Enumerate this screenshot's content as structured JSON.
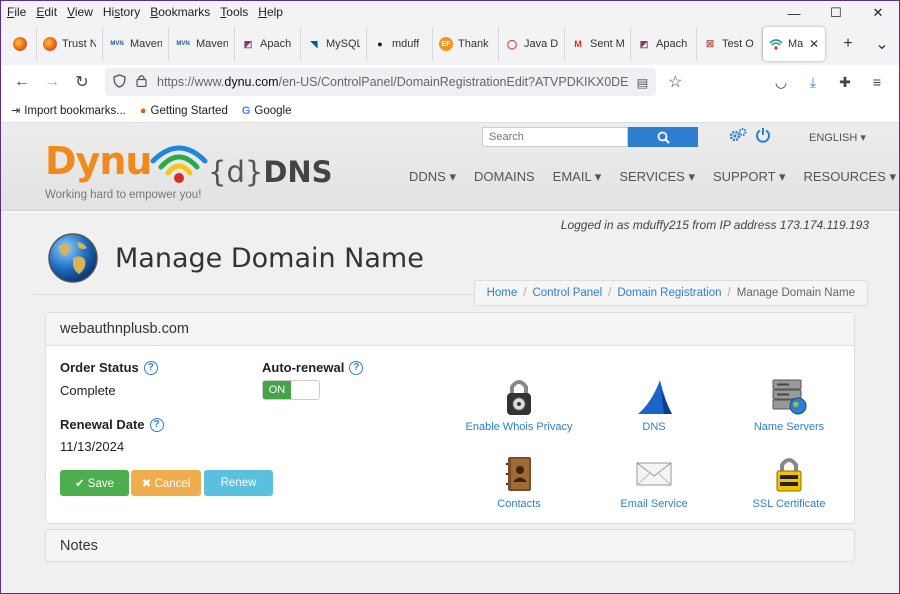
{
  "menubar": {
    "items": [
      {
        "pre": "",
        "ul": "F",
        "post": "ile"
      },
      {
        "pre": "",
        "ul": "E",
        "post": "dit"
      },
      {
        "pre": "",
        "ul": "V",
        "post": "iew"
      },
      {
        "pre": "Hi",
        "ul": "s",
        "post": "tory"
      },
      {
        "pre": "",
        "ul": "B",
        "post": "ookmarks"
      },
      {
        "pre": "",
        "ul": "T",
        "post": "ools"
      },
      {
        "pre": "",
        "ul": "H",
        "post": "elp"
      }
    ]
  },
  "window": {
    "minimize": "—",
    "maximize": "☐",
    "close": "✕"
  },
  "tabs": [
    {
      "label": "Trust Nexu",
      "icon": "firefox-icon",
      "glyph": "",
      "color": "#e66000"
    },
    {
      "label": "Maven",
      "icon": "maven-icon",
      "glyph": "MVN",
      "color": "#1e5b9c"
    },
    {
      "label": "Maven",
      "icon": "maven-icon",
      "glyph": "MVN",
      "color": "#1e5b9c"
    },
    {
      "label": "Apach",
      "icon": "apache-icon",
      "glyph": "◩",
      "color": "#8a3b6b"
    },
    {
      "label": "MySQL",
      "icon": "mysql-icon",
      "glyph": "◥",
      "color": "#00618a"
    },
    {
      "label": "mduff",
      "icon": "github-icon",
      "glyph": "●",
      "color": "#111111"
    },
    {
      "label": "Thank",
      "icon": "ef-icon",
      "glyph": "EF",
      "color": "#f7941d"
    },
    {
      "label": "Java D",
      "icon": "oracle-icon",
      "glyph": "◯",
      "color": "#e0301e"
    },
    {
      "label": "Sent M",
      "icon": "gmail-icon",
      "glyph": "M",
      "color": "#d93025"
    },
    {
      "label": "Apach",
      "icon": "apache-icon",
      "glyph": "◩",
      "color": "#8a3b6b"
    },
    {
      "label": "Test O",
      "icon": "test-icon",
      "glyph": "☒",
      "color": "#b03a2e"
    },
    {
      "label": "Mai",
      "icon": "dynu-wifi-icon",
      "glyph": "",
      "color": "#2e9b3a",
      "active": true
    }
  ],
  "tab_tools": {
    "new_tab": "+",
    "list_all": "⌄"
  },
  "nav": {
    "back": "←",
    "forward": "→",
    "reload": "↻",
    "url_prefix": "https://www.",
    "url_domain": "dynu.com",
    "url_rest": "/en-US/ControlPanel/DomainRegistrationEdit?ATVPDKIKX0DE",
    "reader": "▤",
    "star": "☆",
    "pocket": "◡",
    "download": "⤓",
    "extensions": "✚",
    "menu": "≡"
  },
  "bookmarks": [
    {
      "label": "Import bookmarks...",
      "icon": "import-icon",
      "glyph": "⇥"
    },
    {
      "label": "Getting Started",
      "icon": "firefox-icon",
      "glyph": "●"
    },
    {
      "label": "Google",
      "icon": "google-icon",
      "glyph": "G"
    }
  ],
  "header": {
    "logo_text": "Dynu",
    "tagline": "Working hard to empower you!",
    "ddns_brace": "{d}",
    "ddns_text": "DNS",
    "search_placeholder": "Search",
    "lang": "ENGLISH ▾",
    "nav": [
      "DDNS ▾",
      "DOMAINS",
      "EMAIL ▾",
      "SERVICES ▾",
      "SUPPORT ▾",
      "RESOURCES ▾"
    ]
  },
  "session": {
    "logged_in": "Logged in as mduffy215 from IP address 173.174.119.193"
  },
  "page": {
    "title": "Manage Domain Name"
  },
  "breadcrumb": {
    "items": [
      "Home",
      "Control Panel",
      "Domain Registration"
    ],
    "current": "Manage Domain Name"
  },
  "domain": {
    "name": "webauthnplusb.com",
    "order_status_label": "Order Status",
    "order_status": "Complete",
    "auto_renewal_label": "Auto-renewal",
    "auto_renewal_state": "ON",
    "renewal_date_label": "Renewal Date",
    "renewal_date": "11/13/2024"
  },
  "actions": {
    "save": "✔ Save",
    "cancel": "✖ Cancel",
    "renew": "Renew"
  },
  "features": [
    {
      "label": "Enable Whois Privacy",
      "icon": "padlock-icon"
    },
    {
      "label": "DNS",
      "icon": "dns-sail-icon"
    },
    {
      "label": "Name Servers",
      "icon": "server-globe-icon"
    },
    {
      "label": "Contacts",
      "icon": "address-book-icon"
    },
    {
      "label": "Email Service",
      "icon": "envelope-icon"
    },
    {
      "label": "SSL Certificate",
      "icon": "ssl-lock-icon"
    }
  ],
  "notes": {
    "title": "Notes"
  },
  "colors": {
    "accent": "#2f7fd1",
    "brand_orange": "#f08a1d",
    "success": "#4cae4c",
    "warning": "#f0ad4e",
    "info": "#5bc0de"
  }
}
